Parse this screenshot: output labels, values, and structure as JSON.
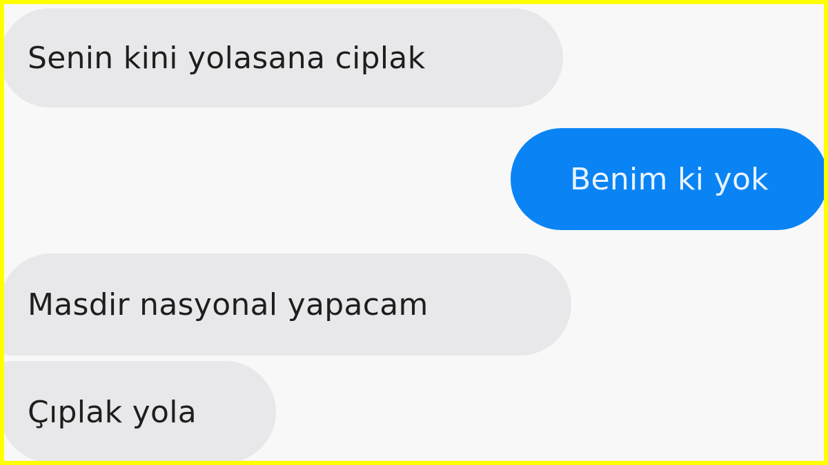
{
  "conversation": {
    "messages": [
      {
        "sender": "other",
        "text": "Senin kini yolasana ciplak"
      },
      {
        "sender": "me",
        "text": "Benim ki yok"
      },
      {
        "sender": "other",
        "text": "Masdir nasyonal yapacam"
      },
      {
        "sender": "other",
        "text": "Çıplak yola"
      }
    ]
  },
  "colors": {
    "frame_border": "#ffff00",
    "background": "#f8f8f9",
    "incoming_bubble": "#e8e8ea",
    "outgoing_bubble": "#0a84f4",
    "incoming_text": "#1e1e1e",
    "outgoing_text": "#e9f3ff"
  }
}
